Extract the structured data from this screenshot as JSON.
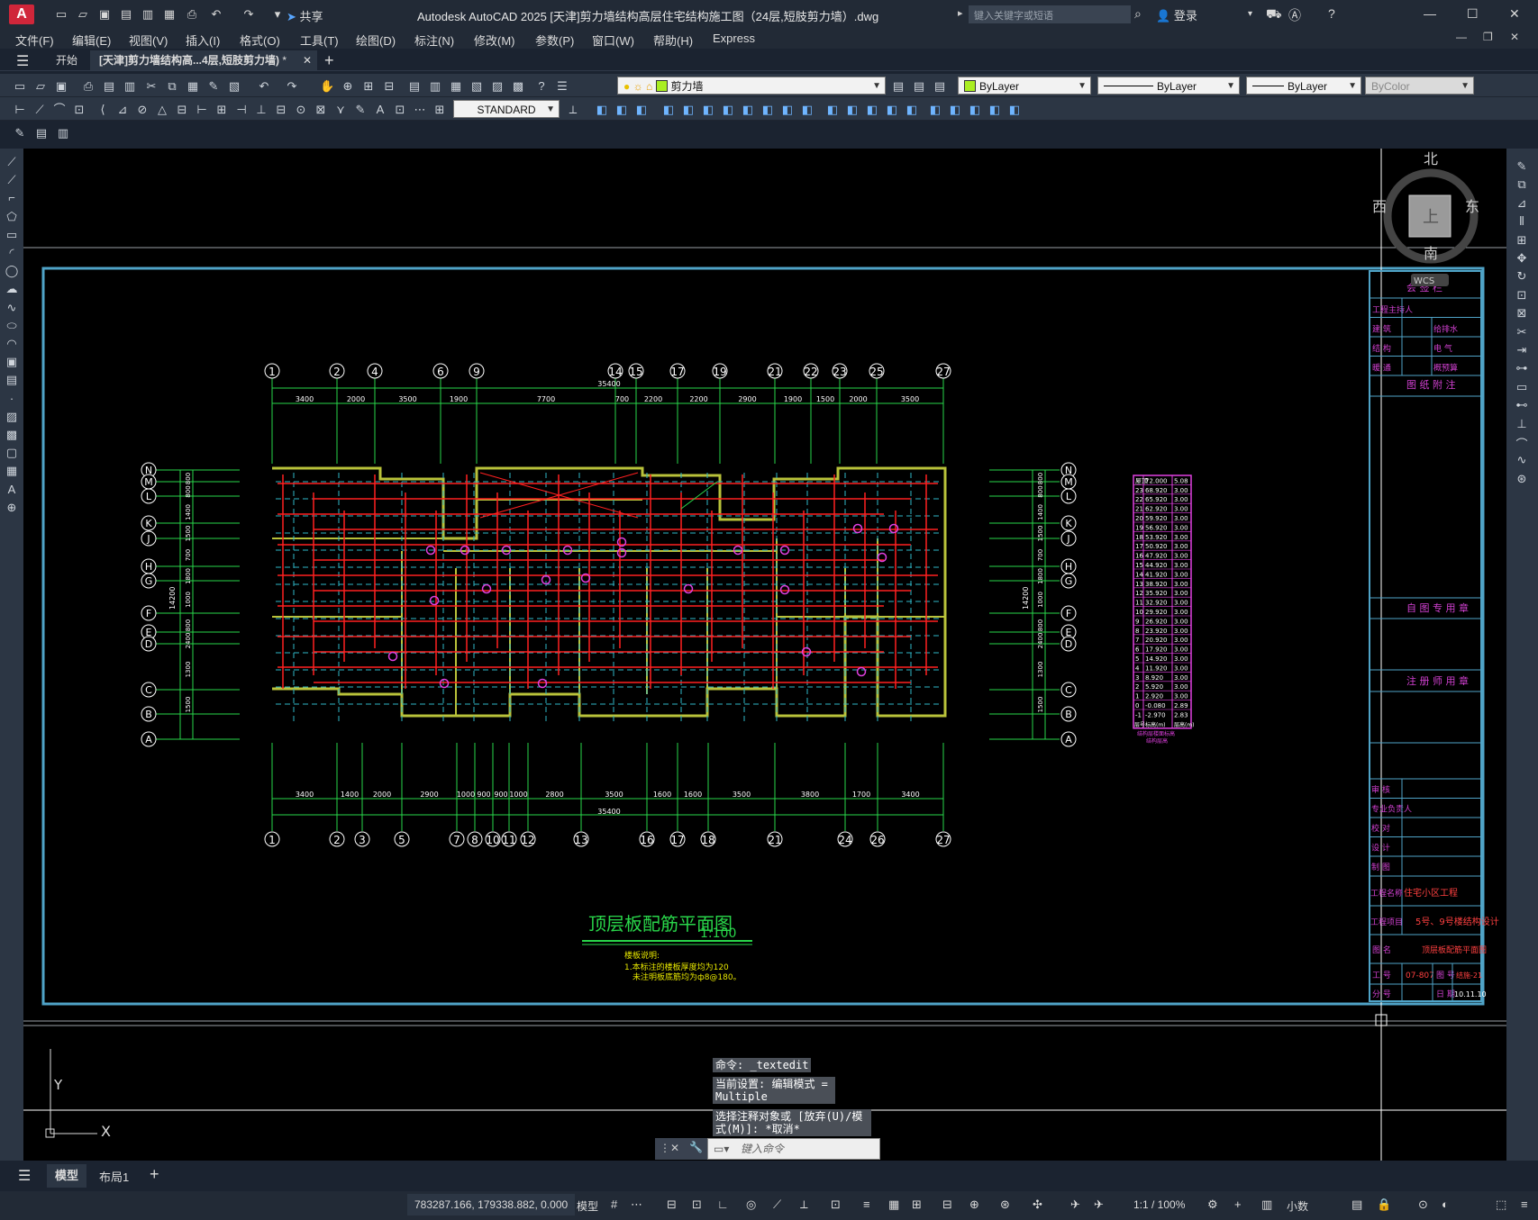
{
  "app": {
    "title": "Autodesk AutoCAD 2025    [天津]剪力墙结构高层住宅结构施工图（24层,短肢剪力墙）.dwg",
    "share_label": "共享",
    "search_placeholder": "键入关键字或短语",
    "login_label": "登录"
  },
  "menu": [
    "文件(F)",
    "编辑(E)",
    "视图(V)",
    "插入(I)",
    "格式(O)",
    "工具(T)",
    "绘图(D)",
    "标注(N)",
    "修改(M)",
    "参数(P)",
    "窗口(W)",
    "帮助(H)",
    "Express"
  ],
  "tabs": {
    "start": "开始",
    "active": "[天津]剪力墙结构高...4层,短肢剪力墙)",
    "active_modified": "*"
  },
  "properties": {
    "layer": "剪力墙",
    "layer_color": "#aaee22",
    "color": "ByLayer",
    "linetype": "ByLayer",
    "lineweight": "ByLayer",
    "plotstyle": "ByColor",
    "textstyle": "STANDARD"
  },
  "viewcube": {
    "north": "北",
    "south": "南",
    "east": "东",
    "west": "西",
    "top": "上",
    "wcs": "WCS"
  },
  "ucs": {
    "x": "X",
    "y": "Y"
  },
  "drawing": {
    "title": "顶层板配筋平面图",
    "scale": "1:100",
    "notes_title": "楼板说明:",
    "note1": "1.本标注的楼板厚度均为120",
    "note2": "未注明板底筋均为ф8@180。",
    "top_axes": [
      "1",
      "2",
      "4",
      "6",
      "9",
      "14",
      "15",
      "17",
      "19",
      "21",
      "22",
      "23",
      "25",
      "27"
    ],
    "bottom_axes": [
      "1",
      "2",
      "3",
      "5",
      "7",
      "8",
      "10",
      "11",
      "12",
      "13",
      "16",
      "17",
      "18",
      "21",
      "24",
      "26",
      "27"
    ],
    "row_axes": [
      "N",
      "M",
      "L",
      "K",
      "J",
      "H",
      "G",
      "F",
      "E",
      "D",
      "C",
      "B",
      "A"
    ],
    "top_dims": [
      "3400",
      "2000",
      "3500",
      "1900",
      "7700",
      "700",
      "2200",
      "2200",
      "2900",
      "1900",
      "1500",
      "2000",
      "3500"
    ],
    "top_total": "35400",
    "bottom_dims": [
      "3400",
      "1400",
      "2000",
      "2900",
      "1000",
      "900",
      "900",
      "1000",
      "2800",
      "3500",
      "1600",
      "1600",
      "3500",
      "3800",
      "1700",
      "3400"
    ],
    "bottom_total": "35400",
    "left_dims": [
      "800",
      "800",
      "1400",
      "1500",
      "700",
      "1800",
      "1000",
      "800",
      "2400",
      "1300",
      "1500"
    ],
    "left_total": "14200"
  },
  "level_table": {
    "header": [
      "层号",
      "标高(m)",
      "层高(m)"
    ],
    "rows": [
      [
        "屋顶",
        "72.000",
        "5.08"
      ],
      [
        "23",
        "68.920",
        "3.00"
      ],
      [
        "22",
        "65.920",
        "3.00"
      ],
      [
        "21",
        "62.920",
        "3.00"
      ],
      [
        "20",
        "59.920",
        "3.00"
      ],
      [
        "19",
        "56.920",
        "3.00"
      ],
      [
        "18",
        "53.920",
        "3.00"
      ],
      [
        "17",
        "50.920",
        "3.00"
      ],
      [
        "16",
        "47.920",
        "3.00"
      ],
      [
        "15",
        "44.920",
        "3.00"
      ],
      [
        "14",
        "41.920",
        "3.00"
      ],
      [
        "13",
        "38.920",
        "3.00"
      ],
      [
        "12",
        "35.920",
        "3.00"
      ],
      [
        "11",
        "32.920",
        "3.00"
      ],
      [
        "10",
        "29.920",
        "3.00"
      ],
      [
        "9",
        "26.920",
        "3.00"
      ],
      [
        "8",
        "23.920",
        "3.00"
      ],
      [
        "7",
        "20.920",
        "3.00"
      ],
      [
        "6",
        "17.920",
        "3.00"
      ],
      [
        "5",
        "14.920",
        "3.00"
      ],
      [
        "4",
        "11.920",
        "3.00"
      ],
      [
        "3",
        "8.920",
        "3.00"
      ],
      [
        "2",
        "5.920",
        "3.00"
      ],
      [
        "1",
        "2.920",
        "3.00"
      ],
      [
        "0",
        "-0.080",
        "2.89"
      ],
      [
        "-1",
        "-2.970",
        "2.83"
      ]
    ],
    "caption": "结构层楼面标高",
    "caption2": "结构层高"
  },
  "title_block": {
    "countersign": "会 签 栏",
    "rows_top": [
      [
        "工程主持人",
        ""
      ],
      [
        "建 筑",
        "给排水"
      ],
      [
        "结 构",
        "电 气"
      ],
      [
        "暖 通",
        "概预算"
      ]
    ],
    "notes": "图 纸 附 注",
    "self_use": "自 图 专 用 章",
    "reg_use": "注 册 师 用 章",
    "rows_bottom": [
      "审 核",
      "专业负责人",
      "校 对",
      "设 计",
      "制 图"
    ],
    "project_name_label": "工程名称",
    "project_name": "住宅小区工程",
    "project_item_label": "工程项目",
    "project_item": "5号、9号楼结构设计",
    "drawing_name_label": "图 名",
    "drawing_name": "顶层板配筋平面图",
    "job_no_label": "工 号",
    "job_no": "07-807",
    "sheet_no_label": "图 号",
    "sheet_no": "结施-21",
    "part_label": "分 号",
    "date_label": "日 期",
    "date": "10.11.10"
  },
  "command": {
    "history1": "命令: _textedit",
    "history2": "当前设置: 编辑模式 = Multiple",
    "history3": "选择注释对象或 [放弃(U)/模式(M)]: *取消*",
    "placeholder": "键入命令"
  },
  "layouts": {
    "model": "模型",
    "layout1": "布局1"
  },
  "status": {
    "coords": "783287.166, 179338.882, 0.000",
    "mode": "模型",
    "annotation_scale": "1:1 / 100%",
    "units": "小数"
  }
}
